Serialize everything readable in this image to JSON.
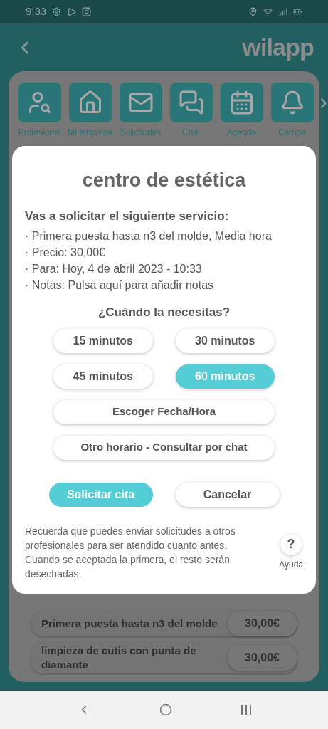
{
  "status_bar": {
    "time": "9:33"
  },
  "header": {
    "logo": "wilapp"
  },
  "menu": [
    {
      "label": "Profesional",
      "kind": "profesional"
    },
    {
      "label": "Mi empresa",
      "kind": "empresa"
    },
    {
      "label": "Solicitudes",
      "kind": "solicitudes"
    },
    {
      "label": "Chat",
      "kind": "chat"
    },
    {
      "label": "Agenda",
      "kind": "agenda"
    },
    {
      "label": "Campa",
      "kind": "campaign"
    }
  ],
  "services": [
    {
      "name": "Primera puesta hasta n3 del molde",
      "price": "30,00€"
    },
    {
      "name": "limpieza de cutis con punta de diamante",
      "price": "30,00€"
    }
  ],
  "dialog": {
    "title": "centro de estética",
    "subtitle": "Vas a solicitar el siguiente servicio:",
    "details": [
      "· Primera puesta hasta n3 del molde, Media hora",
      "· Precio: 30,00€",
      "· Para: Hoy, 4 de abril 2023 - 10:33",
      "· Notas: Pulsa aquí para añadir notas"
    ],
    "question": "¿Cuándo la necesitas?",
    "durations": [
      {
        "label": "15 minutos",
        "selected": false
      },
      {
        "label": "30 minutos",
        "selected": false
      },
      {
        "label": "45 minutos",
        "selected": false
      },
      {
        "label": "60 minutos",
        "selected": true
      }
    ],
    "options": [
      "Escoger Fecha/Hora",
      "Otro horario - Consultar por chat"
    ],
    "submit": "Solicitar cita",
    "cancel": "Cancelar",
    "note": "Recuerda que puedes enviar solicitudes a otros profesionales para ser atendido cuanto antes. Cuando se aceptada la primera, el resto serán desechadas.",
    "help": {
      "symbol": "?",
      "label": "Ayuda"
    }
  }
}
